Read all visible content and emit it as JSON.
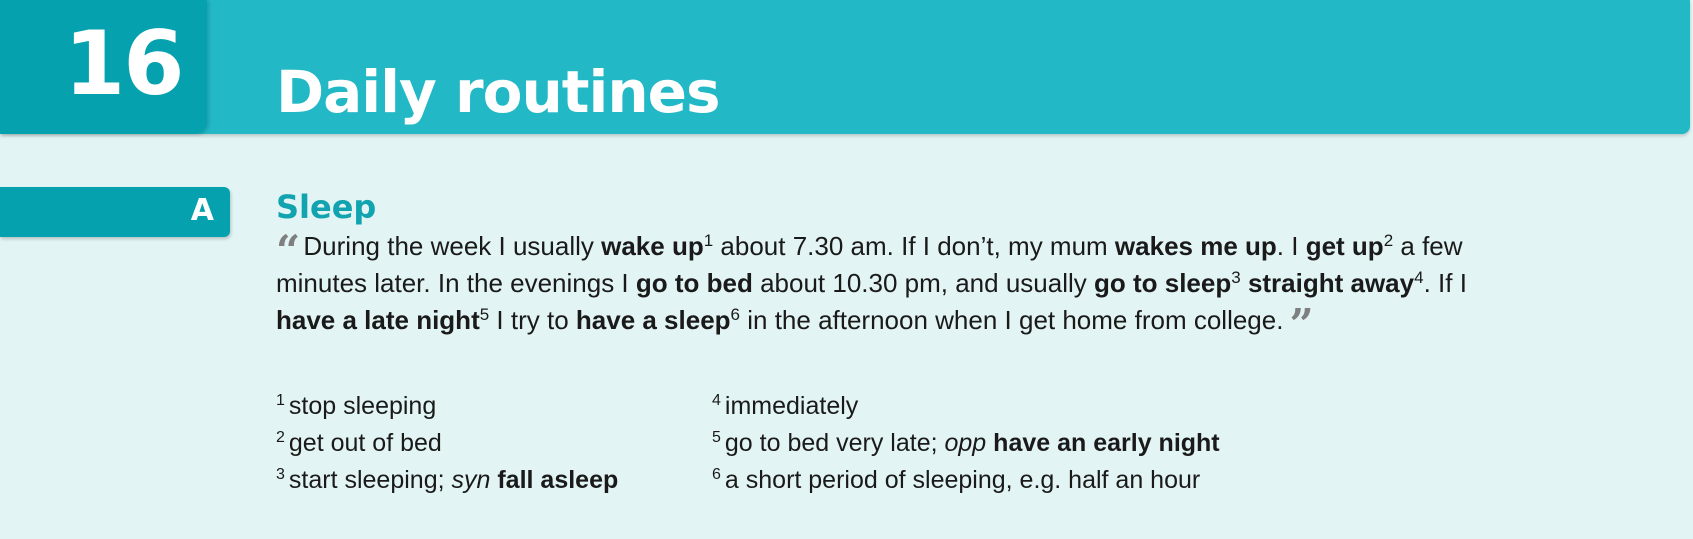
{
  "header": {
    "unit_number": "16",
    "unit_title": "Daily routines"
  },
  "section": {
    "letter": "A",
    "title": "Sleep"
  },
  "passage": {
    "open_quote": "“",
    "close_quote": "”",
    "segments": {
      "s1": "During the week I usually ",
      "b1": "wake up",
      "n1": "1",
      "s2": " about 7.30 am. If I don’t, my mum ",
      "b2": "wakes me up",
      "s3": ". I ",
      "b3": "get up",
      "n2": "2",
      "s4": " a few minutes later. In the evenings I ",
      "b4": "go to bed",
      "s5": " about 10.30 pm, and usually ",
      "b5": "go to sleep",
      "n3": "3",
      "s6": " ",
      "b6": "straight away",
      "n4": "4",
      "s7": ". If I ",
      "b7": "have a late night",
      "n5": "5",
      "s8": " I try to ",
      "b8": "have a sleep",
      "n6": "6",
      "s9": " in the afternoon when I get home from college."
    }
  },
  "glossary": {
    "left": [
      {
        "num": "1",
        "text": "stop sleeping"
      },
      {
        "num": "2",
        "text": "get out of bed"
      },
      {
        "num": "3",
        "text": "start sleeping; ",
        "label": "syn",
        "bold": "fall asleep"
      }
    ],
    "right": [
      {
        "num": "4",
        "text": "immediately"
      },
      {
        "num": "5",
        "text": "go to bed very late; ",
        "label": "opp",
        "bold": "have an early night"
      },
      {
        "num": "6",
        "text": "a short period of sleeping, e.g. half an hour"
      }
    ]
  },
  "colors": {
    "header_bar": "#22b8c6",
    "unit_box": "#05a1ae",
    "page_background": "#e2f4f3",
    "section_title": "#12a3b0",
    "quote_marks": "#7f7f7f"
  }
}
